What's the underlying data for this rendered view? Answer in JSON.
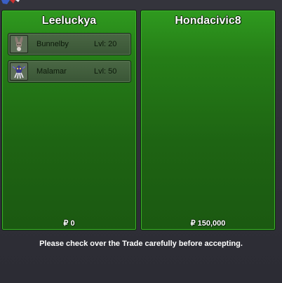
{
  "trade": {
    "left": {
      "player": "Leeluckya",
      "money": "₽ 0",
      "pokemon": [
        {
          "name": "Bunnelby",
          "level": "Lvl: 20",
          "icon": "bunnelby-icon"
        },
        {
          "name": "Malamar",
          "level": "Lvl: 50",
          "icon": "malamar-icon"
        }
      ]
    },
    "right": {
      "player": "Hondacivic8",
      "money": "₽ 150,000",
      "pokemon": []
    },
    "notice": "Please check over the Trade carefully before accepting."
  },
  "colors": {
    "panel_green": "#257d17",
    "panel_dark_green": "#1b5911",
    "background": "#2e2e36",
    "row_bg": "#4a6744"
  }
}
